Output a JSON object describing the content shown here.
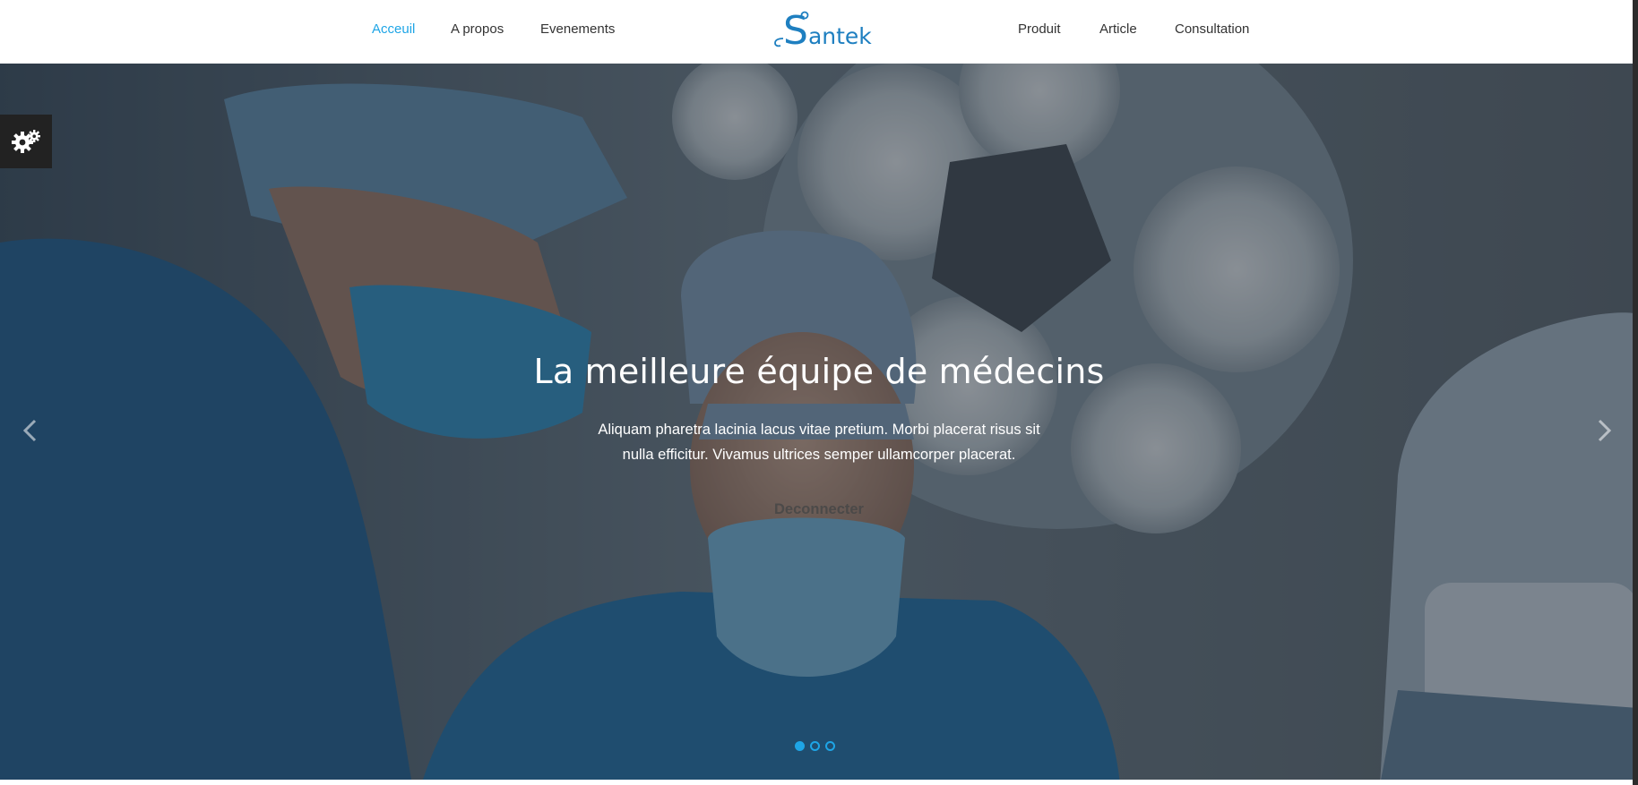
{
  "nav": {
    "left": [
      {
        "label": "Acceuil",
        "active": true
      },
      {
        "label": "A propos",
        "active": false
      },
      {
        "label": "Evenements",
        "active": false
      }
    ],
    "right": [
      {
        "label": "Produit",
        "active": false
      },
      {
        "label": "Article",
        "active": false
      },
      {
        "label": "Consultation",
        "active": false
      }
    ]
  },
  "logo": {
    "initial": "S",
    "rest": "antek"
  },
  "hero": {
    "title": "La meilleure équipe de médecins",
    "text_line1": "Aliquam pharetra lacinia lacus vitae pretium. Morbi placerat risus sit",
    "text_line2": "nulla efficitur. Vivamus ultrices semper ullamcorper placerat.",
    "button_label": "Deconnecter",
    "slides": 3,
    "active_slide": 1
  },
  "icons": {
    "settings": "gears-icon",
    "prev": "chevron-left-icon",
    "next": "chevron-right-icon"
  },
  "colors": {
    "accent": "#1ea5e6",
    "logo": "#1e7fc0",
    "nav_text": "#333333",
    "settings_bg": "#222222"
  }
}
